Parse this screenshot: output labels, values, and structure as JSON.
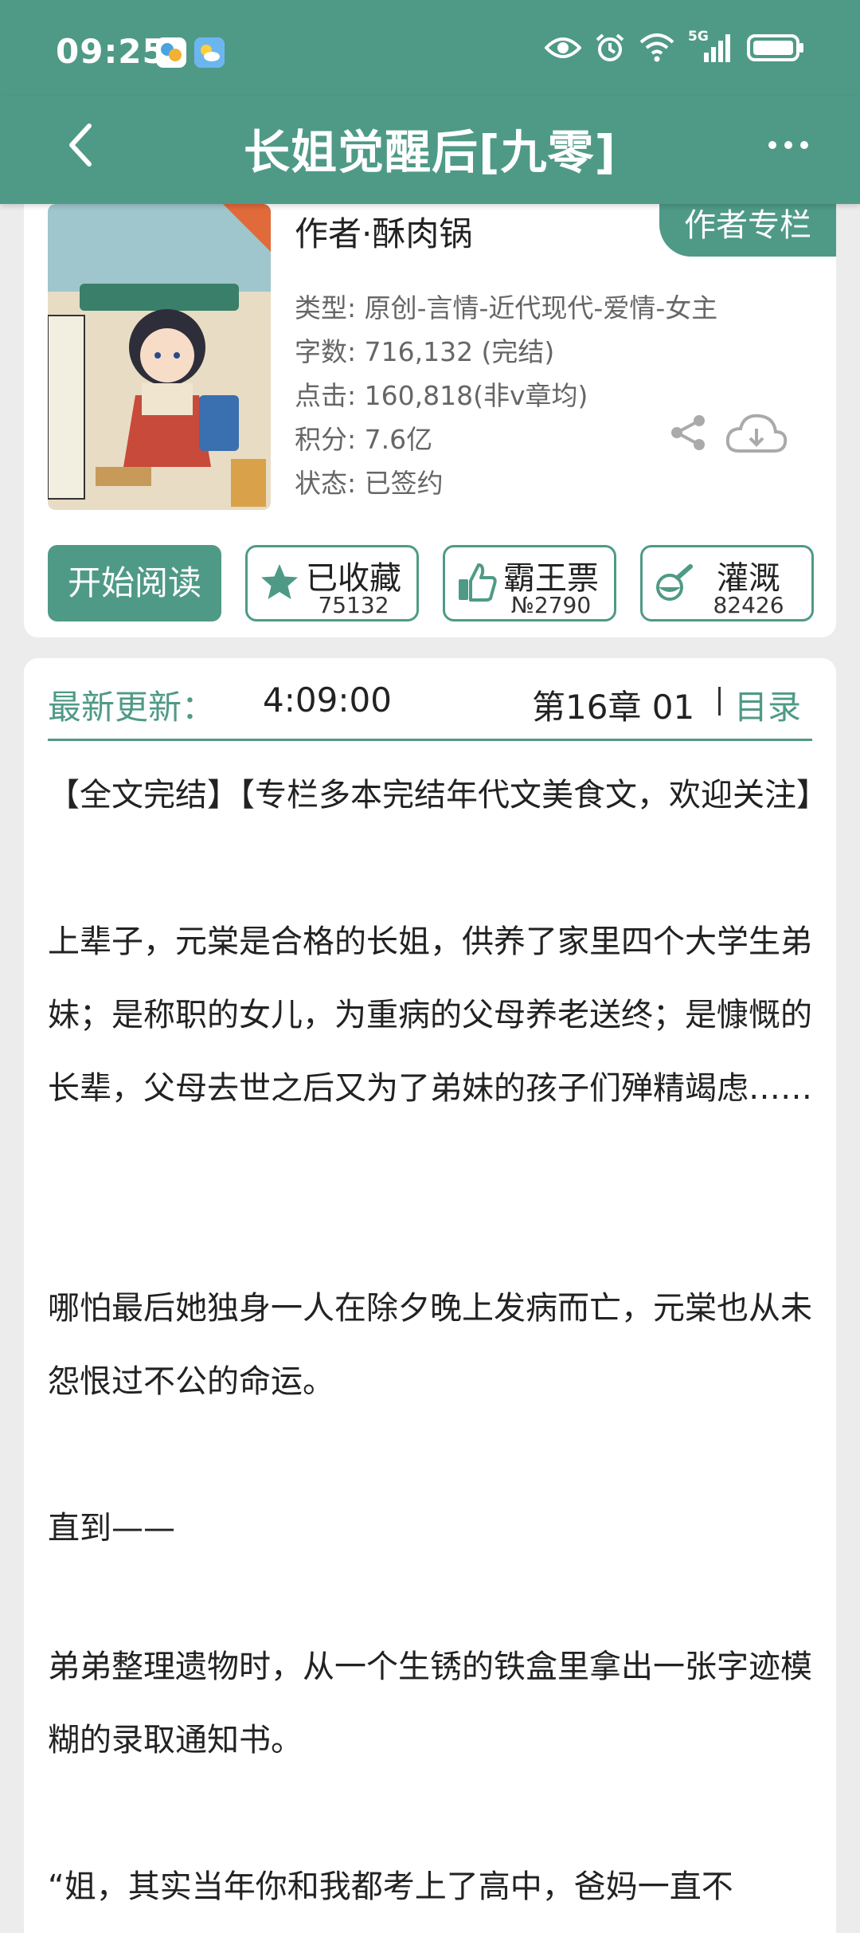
{
  "status_bar": {
    "time": "09:25",
    "network": "5G",
    "icons": [
      "app-icon-1",
      "app-icon-2",
      "eye-icon",
      "alarm-icon",
      "wifi-icon",
      "signal-icon",
      "battery-icon"
    ]
  },
  "app_bar": {
    "title": "长姐觉醒后[九零]",
    "back_icon": "back-chevron-icon",
    "more_icon": "more-dots-icon"
  },
  "book": {
    "author": "作者·酥肉锅",
    "author_column_label": "作者专栏",
    "type": "类型: 原创-言情-近代现代-爱情-女主",
    "word_count": "字数: 716,132 (完结)",
    "clicks": "点击: 160,818(非v章均)",
    "score": "积分: 7.6亿",
    "status": "状态: 已签约"
  },
  "actions": {
    "read_label": "开始阅读",
    "collect": {
      "label": "已收藏",
      "count": "75132"
    },
    "ticket": {
      "label": "霸王票",
      "count": "№2790"
    },
    "irrigate": {
      "label": "灌溉",
      "count": "82426"
    }
  },
  "latest_update": {
    "label": "最新更新：",
    "time": "4:09:00",
    "chapter": "第16章  01",
    "toc_label": "目录"
  },
  "synopsis": [
    "【全文完结】【专栏多本完结年代文美食文，欢迎关注】",
    "上辈子，元棠是合格的长姐，供养了家里四个大学生弟妹；是称职的女儿，为重病的父母养老送终；是慷慨的长辈，父母去世之后又为了弟妹的孩子们殚精竭虑……",
    "哪怕最后她独身一人在除夕晚上发病而亡，元棠也从未怨恨过不公的命运。",
    "直到——",
    "弟弟整理遗物时，从一个生锈的铁盒里拿出一张字迹模糊的录取通知书。",
    "“姐，其实当年你和我都考上了高中，爸妈一直不"
  ],
  "colors": {
    "accent": "#4f9a86",
    "background": "#ececec",
    "card": "#ffffff"
  }
}
